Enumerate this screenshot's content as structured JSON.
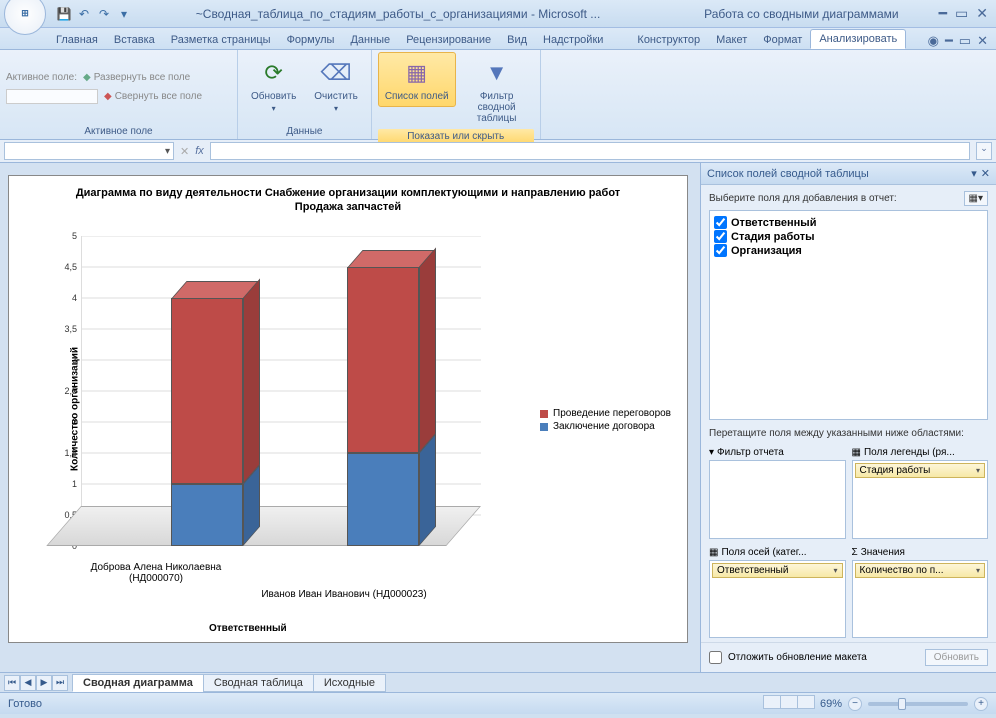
{
  "title": "~Сводная_таблица_по_стадиям_работы_с_организациями - Microsoft ...",
  "context_title": "Работа со сводными диаграммами",
  "tabs": [
    "Главная",
    "Вставка",
    "Разметка страницы",
    "Формулы",
    "Данные",
    "Рецензирование",
    "Вид",
    "Надстройки"
  ],
  "context_tabs": [
    "Конструктор",
    "Макет",
    "Формат",
    "Анализировать"
  ],
  "active_tab": "Анализировать",
  "ribbon": {
    "active_field_label": "Активное поле:",
    "expand_all": "Развернуть все поле",
    "collapse_all": "Свернуть все поле",
    "group_active_field": "Активное поле",
    "refresh": "Обновить",
    "clear": "Очистить",
    "group_data": "Данные",
    "field_list": "Список полей",
    "filter": "Фильтр сводной таблицы",
    "group_show_hide": "Показать или скрыть"
  },
  "chart_data": {
    "type": "bar",
    "title_line1": "Диаграмма по виду деятельности Снабжение организации комплектующими и направлению работ",
    "title_line2": "Продажа запчастей",
    "y_axis_title": "Количество организаций",
    "x_axis_title": "Ответственный",
    "categories": [
      "Доброва Алена Николаевна (НД000070)",
      "Иванов Иван Иванович (НД000023)"
    ],
    "series": [
      {
        "name": "Заключение договора",
        "color": "#4a7ebb",
        "values": [
          1,
          1.5
        ]
      },
      {
        "name": "Проведение переговоров",
        "color": "#be4b48",
        "values": [
          3,
          3
        ]
      }
    ],
    "y_ticks": [
      "0",
      "0,5",
      "1",
      "1,5",
      "2",
      "2,5",
      "3",
      "3,5",
      "4",
      "4,5",
      "5"
    ],
    "ylim": [
      0,
      5
    ]
  },
  "pane": {
    "title": "Список полей сводной таблицы",
    "choose_fields": "Выберите поля для добавления в отчет:",
    "fields": [
      "Ответственный",
      "Стадия работы",
      "Организация"
    ],
    "drag_hint": "Перетащите поля между указанными ниже областями:",
    "zone_filter": "Фильтр отчета",
    "zone_legend": "Поля легенды (ря...",
    "zone_axis": "Поля осей (катег...",
    "zone_values": "Значения",
    "pill_legend": "Стадия работы",
    "pill_axis": "Ответственный",
    "pill_values": "Количество по п...",
    "defer": "Отложить обновление макета",
    "update_btn": "Обновить"
  },
  "sheets": [
    "Сводная диаграмма",
    "Сводная таблица",
    "Исходные"
  ],
  "active_sheet": "Сводная диаграмма",
  "status": {
    "ready": "Готово",
    "zoom": "69%"
  }
}
